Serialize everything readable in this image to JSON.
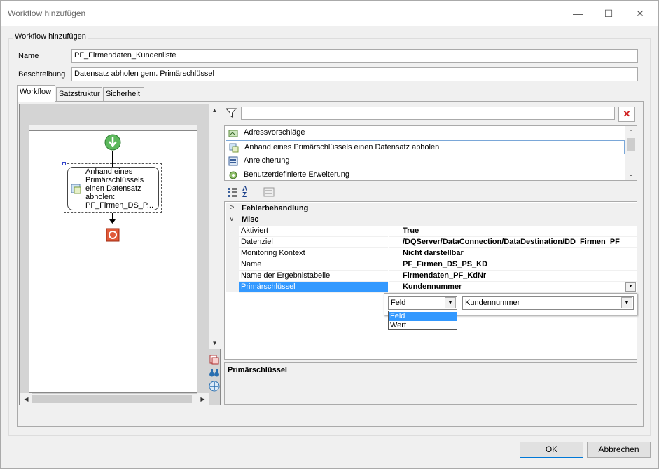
{
  "window": {
    "title": "Workflow hinzufügen"
  },
  "group": {
    "label": "Workflow hinzufügen"
  },
  "form": {
    "name_label": "Name",
    "name_value": "PF_Firmendaten_Kundenliste",
    "desc_label": "Beschreibung",
    "desc_value": "Datensatz abholen gem. Primärschlüssel"
  },
  "tabs": [
    {
      "label": "Workflow"
    },
    {
      "label": "Satzstruktur"
    },
    {
      "label": "Sicherheit"
    }
  ],
  "workflow": {
    "node_text": "Anhand eines\nPrimärschlüssels\neinen Datensatz\nabholen:\nPF_Firmen_DS_P..."
  },
  "filter": {
    "value": ""
  },
  "activities": [
    {
      "label": "Adressvorschläge"
    },
    {
      "label": "Anhand eines Primärschlüssels einen Datensatz abholen"
    },
    {
      "label": "Anreicherung"
    },
    {
      "label": "Benutzerdefinierte Erweiterung"
    }
  ],
  "properties": {
    "categories": [
      {
        "label": "Fehlerbehandlung",
        "arrow": ">"
      },
      {
        "label": "Misc",
        "arrow": "v"
      }
    ],
    "rows": [
      {
        "name": "Aktiviert",
        "value": "True"
      },
      {
        "name": "Datenziel",
        "value": "/DQServer/DataConnection/DataDestination/DD_Firmen_PF"
      },
      {
        "name": "Monitoring Kontext",
        "value": "Nicht darstellbar"
      },
      {
        "name": "Name",
        "value": "PF_Firmen_DS_PS_KD"
      },
      {
        "name": "Name der Ergebnistabelle",
        "value": "Firmendaten_PF_KdNr"
      },
      {
        "name": "Primärschlüssel",
        "value": "Kundennummer"
      }
    ],
    "editor": {
      "type_value": "Feld",
      "field_value": "Kundennummer",
      "options": [
        "Feld",
        "Wert"
      ]
    },
    "description_title": "Primärschlüssel"
  },
  "buttons": {
    "ok": "OK",
    "cancel": "Abbrechen"
  }
}
